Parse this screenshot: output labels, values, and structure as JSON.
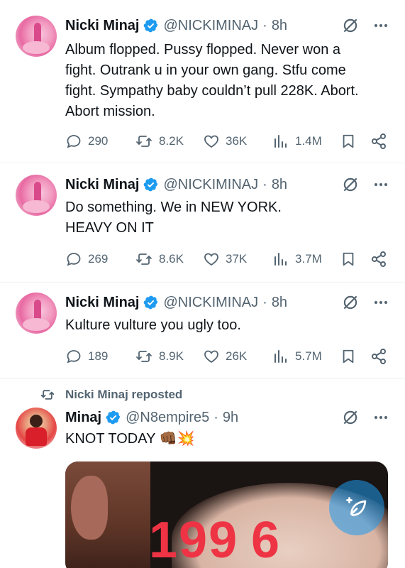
{
  "colors": {
    "accent": "#1d9bf0",
    "secondary_text": "#536471",
    "primary_text": "#0f1419",
    "divider": "#eff3f4"
  },
  "tweets": [
    {
      "name": "Nicki Minaj",
      "handle": "@NICKIMINAJ",
      "time": "8h",
      "text_lines": [
        "Album flopped. Pussy flopped. Never won a",
        "fight. Outrank u in your own gang. Stfu come",
        "fight. Sympathy baby couldn’t pull 228K. Abort.",
        "Abort mission."
      ],
      "replies": "290",
      "reposts": "8.2K",
      "likes": "36K",
      "views": "1.4M"
    },
    {
      "name": "Nicki Minaj",
      "handle": "@NICKIMINAJ",
      "time": "8h",
      "text_lines": [
        "Do something. We in NEW YORK.",
        "HEAVY ON IT"
      ],
      "replies": "269",
      "reposts": "8.6K",
      "likes": "37K",
      "views": "3.7M"
    },
    {
      "name": "Nicki Minaj",
      "handle": "@NICKIMINAJ",
      "time": "8h",
      "text_lines": [
        "Kulture vulture you ugly too."
      ],
      "replies": "189",
      "reposts": "8.9K",
      "likes": "26K",
      "views": "5.7M"
    }
  ],
  "repost": {
    "label": "Nicki Minaj reposted",
    "name": "Minaj",
    "handle": "@N8empire5",
    "time": "9h",
    "text": "KNOT TODAY",
    "emoji": "👊🏾💥",
    "media_text_left": "199",
    "media_text_right": "6"
  },
  "dot_separator": "·",
  "icons": [
    "verified-badge-icon",
    "grok-icon",
    "more-icon",
    "reply-icon",
    "repost-icon",
    "like-icon",
    "views-icon",
    "bookmark-icon",
    "share-icon",
    "compose-icon"
  ]
}
